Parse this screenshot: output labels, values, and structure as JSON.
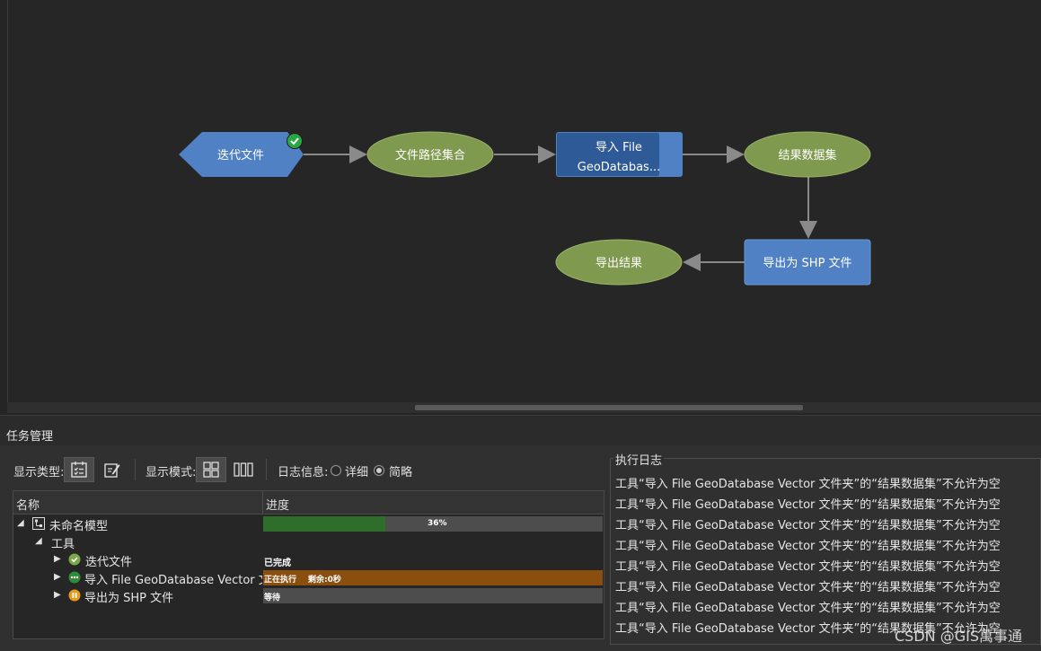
{
  "model": {
    "nodes": {
      "iterate_files": "迭代文件",
      "file_path_set": "文件路径集合",
      "import_tool_line1": "导入 File",
      "import_tool_line2": "GeoDatabas...",
      "result_dataset": "结果数据集",
      "export_shp": "导出为 SHP 文件",
      "export_result": "导出结果"
    },
    "colors": {
      "tool_blue": "#4f81c4",
      "tool_dark_blue": "#2f5a98",
      "data_green": "#7f9a4e",
      "done_green": "#28a745"
    }
  },
  "task_panel": {
    "title": "任务管理",
    "display_type_label": "显示类型:",
    "display_mode_label": "显示模式:",
    "log_info_label": "日志信息:",
    "log_detail_option": "详细",
    "log_brief_option": "简略",
    "log_selected": "简略"
  },
  "tree": {
    "columns": [
      "名称",
      "进度"
    ],
    "rows": {
      "model": {
        "name": "未命名模型",
        "progress_text": "36%",
        "progress": 0.36
      },
      "tools": {
        "name": "工具"
      },
      "iterate": {
        "name": "迭代文件",
        "status": "已完成"
      },
      "import": {
        "name": "导入 File GeoDatabase Vector 文件夹",
        "status": "正在执行",
        "remaining": "剩余:0秒"
      },
      "export": {
        "name": "导出为 SHP 文件",
        "status": "等待"
      }
    }
  },
  "log": {
    "title": "执行日志",
    "lines": [
      "工具“导入 File GeoDatabase Vector 文件夹”的“结果数据集”不允许为空",
      "工具“导入 File GeoDatabase Vector 文件夹”的“结果数据集”不允许为空",
      "工具“导入 File GeoDatabase Vector 文件夹”的“结果数据集”不允许为空",
      "工具“导入 File GeoDatabase Vector 文件夹”的“结果数据集”不允许为空",
      "工具“导入 File GeoDatabase Vector 文件夹”的“结果数据集”不允许为空",
      "工具“导入 File GeoDatabase Vector 文件夹”的“结果数据集”不允许为空",
      "工具“导入 File GeoDatabase Vector 文件夹”的“结果数据集”不允许为空",
      "工具“导入 File GeoDatabase Vector 文件夹”的“结果数据集”不允许为空"
    ]
  },
  "watermark": "CSDN @GIS萬事通"
}
